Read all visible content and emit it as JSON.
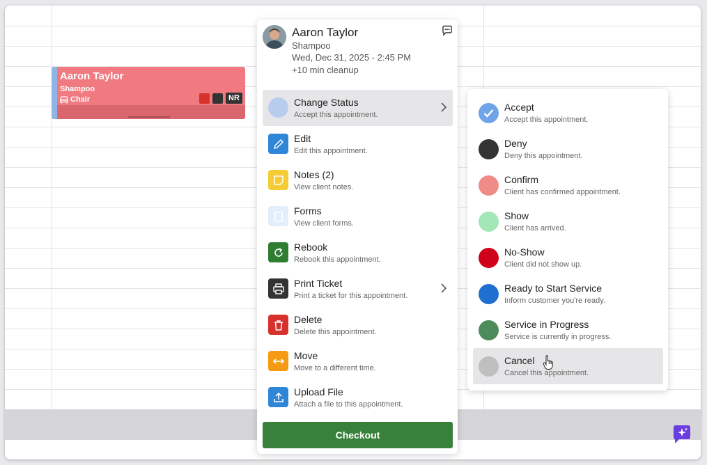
{
  "appointment": {
    "client": "Aaron Taylor",
    "service": "Shampoo",
    "resource": "Chair",
    "badge": "NR",
    "color": "#f07a80"
  },
  "popup": {
    "client": "Aaron Taylor",
    "service": "Shampoo",
    "datetime": "Wed, Dec 31, 2025 - 2:45 PM",
    "cleanup": "+10 min cleanup",
    "menu": [
      {
        "title": "Change Status",
        "subtitle": "Accept this appointment.",
        "icon": "status-circle-icon",
        "color": "#b8cdee"
      },
      {
        "title": "Edit",
        "subtitle": "Edit this appointment.",
        "icon": "pencil-icon",
        "color": "#2f86d6"
      },
      {
        "title": "Notes (2)",
        "subtitle": "View client notes.",
        "icon": "note-icon",
        "color": "#f5cc35"
      },
      {
        "title": "Forms",
        "subtitle": "View client forms.",
        "icon": "clipboard-icon",
        "color": "#e3eefb"
      },
      {
        "title": "Rebook",
        "subtitle": "Rebook this appointment.",
        "icon": "refresh-icon",
        "color": "#2f7d32"
      },
      {
        "title": "Print Ticket",
        "subtitle": "Print a ticket for this appointment.",
        "icon": "printer-icon",
        "color": "#333333"
      },
      {
        "title": "Delete",
        "subtitle": "Delete this appointment.",
        "icon": "trash-icon",
        "color": "#d7312b"
      },
      {
        "title": "Move",
        "subtitle": "Move to a different time.",
        "icon": "move-arrows-icon",
        "color": "#f59b13"
      },
      {
        "title": "Upload File",
        "subtitle": "Attach a file to this appointment.",
        "icon": "upload-icon",
        "color": "#2f86d6"
      }
    ],
    "checkout_label": "Checkout",
    "checkout_color": "#38813a"
  },
  "status_menu": [
    {
      "title": "Accept",
      "subtitle": "Accept this appointment.",
      "color": "#6fa4e8"
    },
    {
      "title": "Deny",
      "subtitle": "Deny this appointment.",
      "color": "#333333"
    },
    {
      "title": "Confirm",
      "subtitle": "Client has confirmed appointment.",
      "color": "#f08c87"
    },
    {
      "title": "Show",
      "subtitle": "Client has arrived.",
      "color": "#a3e6b8"
    },
    {
      "title": "No-Show",
      "subtitle": "Client did not show up.",
      "color": "#d0021b"
    },
    {
      "title": "Ready to Start Service",
      "subtitle": "Inform customer you're ready.",
      "color": "#1f6fd0"
    },
    {
      "title": "Service in Progress",
      "subtitle": "Service is currently in progress.",
      "color": "#4e8b5a"
    },
    {
      "title": "Cancel",
      "subtitle": "Cancel this appointment.",
      "color": "#bfbfbf"
    }
  ]
}
